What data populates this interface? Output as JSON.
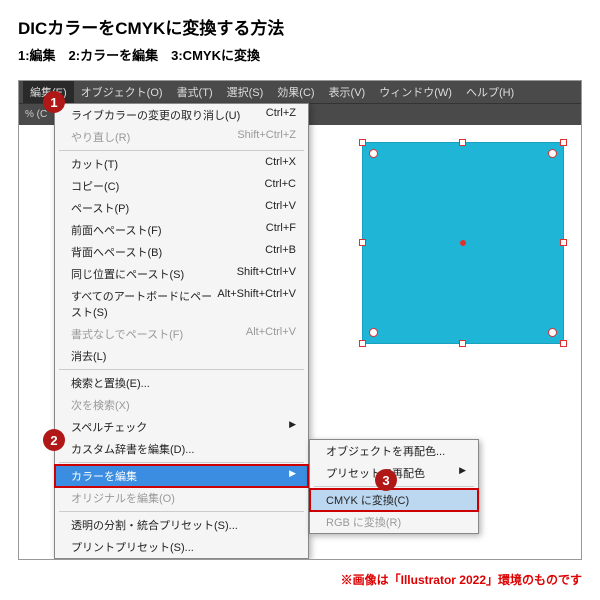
{
  "title": "DICカラーをCMYKに変換する方法",
  "steps": "1:編集　2:カラーを編集　3:CMYKに変換",
  "menubar": [
    "編集(E)",
    "オブジェクト(O)",
    "書式(T)",
    "選択(S)",
    "効果(C)",
    "表示(V)",
    "ウィンドウ(W)",
    "ヘルプ(H)"
  ],
  "toolbar_left": "% (C",
  "menu": {
    "items": [
      {
        "label": "ライブカラーの変更の取り消し(U)",
        "short": "Ctrl+Z"
      },
      {
        "label": "やり直し(R)",
        "short": "Shift+Ctrl+Z",
        "dis": true,
        "sep": true
      },
      {
        "label": "カット(T)",
        "short": "Ctrl+X"
      },
      {
        "label": "コピー(C)",
        "short": "Ctrl+C"
      },
      {
        "label": "ペースト(P)",
        "short": "Ctrl+V"
      },
      {
        "label": "前面へペースト(F)",
        "short": "Ctrl+F"
      },
      {
        "label": "背面へペースト(B)",
        "short": "Ctrl+B"
      },
      {
        "label": "同じ位置にペースト(S)",
        "short": "Shift+Ctrl+V"
      },
      {
        "label": "すべてのアートボードにペースト(S)",
        "short": "Alt+Shift+Ctrl+V"
      },
      {
        "label": "書式なしでペースト(F)",
        "short": "Alt+Ctrl+V",
        "dis": true
      },
      {
        "label": "消去(L)",
        "sep": true
      },
      {
        "label": "検索と置換(E)..."
      },
      {
        "label": "次を検索(X)",
        "dis": true
      },
      {
        "label": "スペルチェック",
        "arrow": true
      },
      {
        "label": "カスタム辞書を編集(D)...",
        "sep": true
      },
      {
        "label": "カラーを編集",
        "arrow": true,
        "hl": true
      },
      {
        "label": "オリジナルを編集(O)",
        "dis": true,
        "sep": true
      },
      {
        "label": "透明の分割・統合プリセット(S)..."
      },
      {
        "label": "プリントプリセット(S)..."
      }
    ]
  },
  "submenu": {
    "items": [
      {
        "label": "オブジェクトを再配色..."
      },
      {
        "label": "プリセットで再配色",
        "arrow": true,
        "sep": true
      },
      {
        "label": "CMYK に変換(C)",
        "hl": true
      },
      {
        "label": "RGB に変換(R)",
        "dis": true
      }
    ]
  },
  "badges": {
    "b1": "1",
    "b2": "2",
    "b3": "3"
  },
  "footer": "※画像は「Illustrator 2022」環境のものです"
}
